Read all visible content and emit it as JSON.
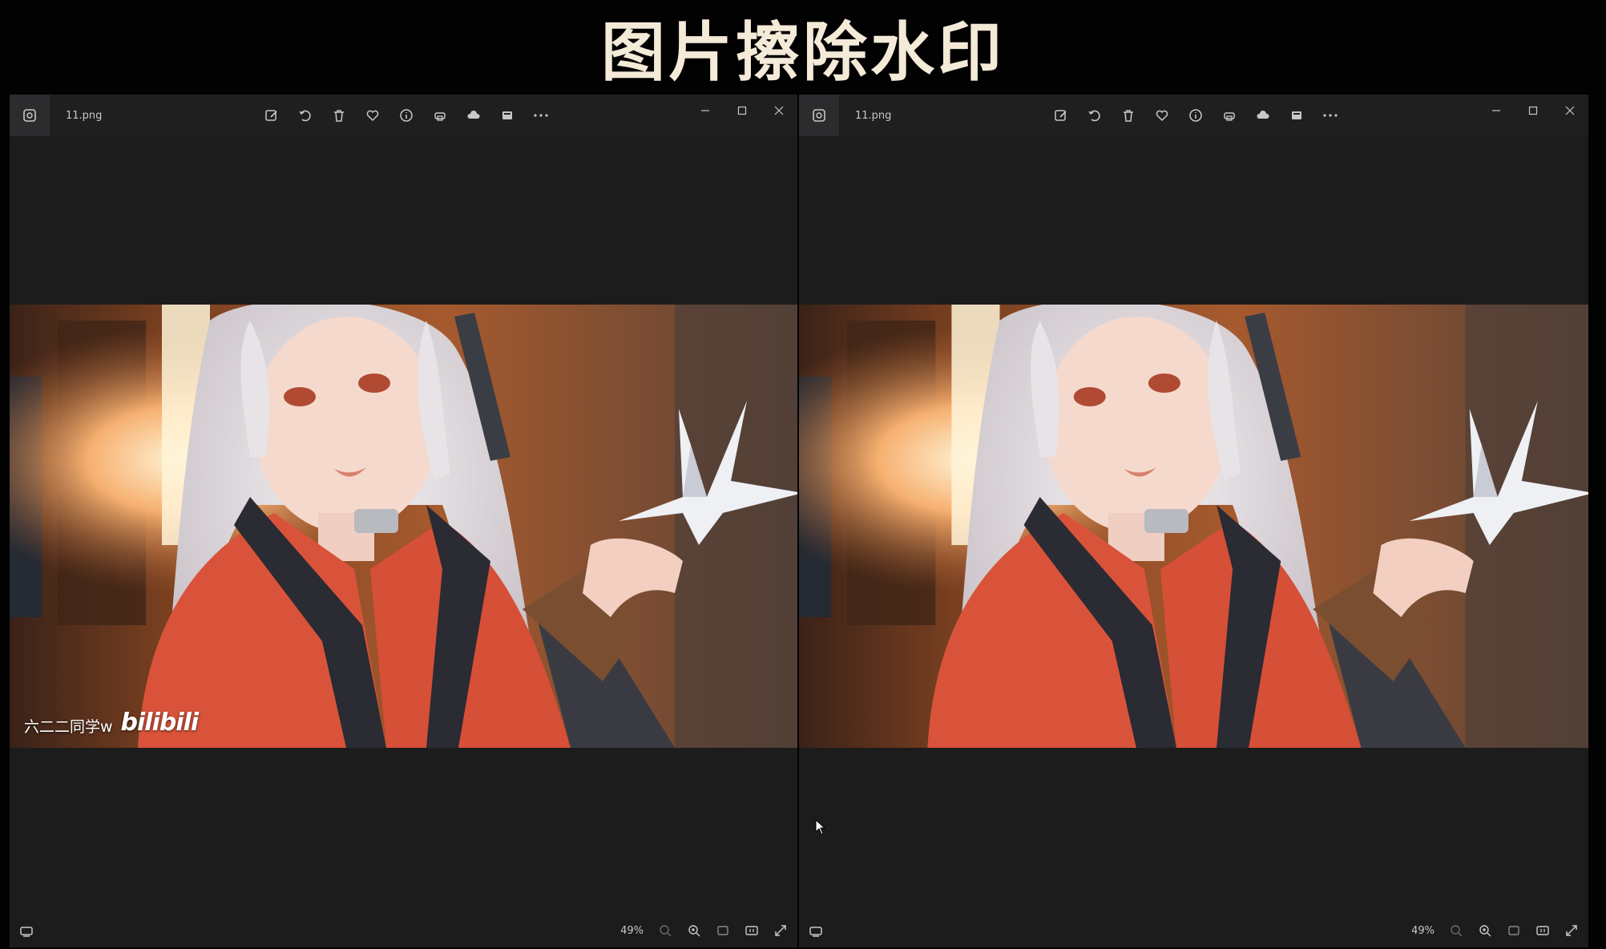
{
  "banner": {
    "title": "图片擦除水印"
  },
  "windows": [
    {
      "side": "left",
      "filename": "11.png",
      "zoom": "49%",
      "watermark": {
        "text": "六二二同学w",
        "logo": "bilibili"
      }
    },
    {
      "side": "right",
      "filename": "11.png",
      "zoom": "49%"
    }
  ],
  "toolbar_icons": [
    "edit-icon",
    "rotate-icon",
    "delete-icon",
    "favorite-icon",
    "info-icon",
    "print-icon",
    "cloud-icon",
    "slideshow-icon",
    "more-icon"
  ],
  "statusbar_icons": [
    "zoom-out-icon",
    "zoom-in-icon",
    "fit-window-icon",
    "actual-size-icon",
    "fullscreen-icon"
  ],
  "colors": {
    "window_bg": "#1c1c1d",
    "titlebar_bg": "#1f1f20",
    "icon": "#c8c8c8",
    "banner_text": "#f4ead8"
  }
}
